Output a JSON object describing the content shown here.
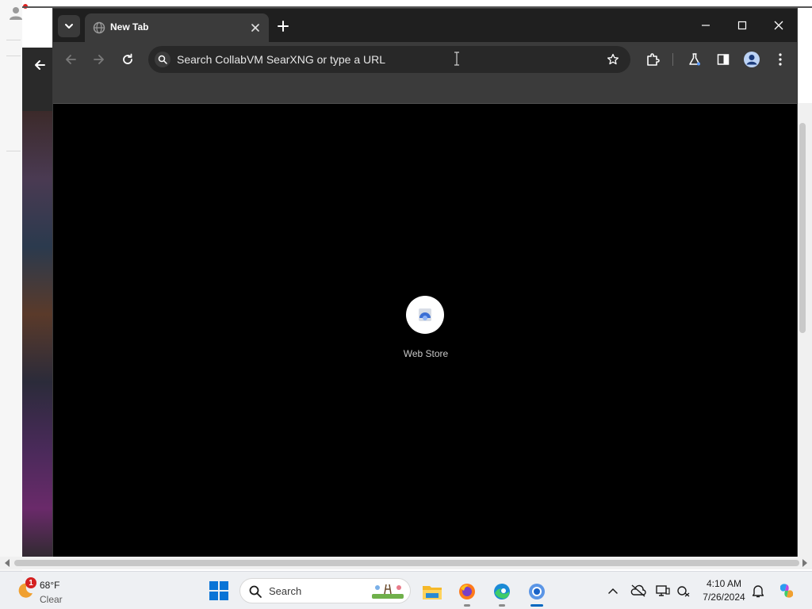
{
  "browser": {
    "tab": {
      "title": "New Tab",
      "favicon": "globe-icon"
    },
    "omnibox": {
      "placeholder": "Search CollabVM SearXNG or type a URL"
    },
    "shortcuts": [
      {
        "label": "Web Store",
        "icon": "web-store-icon"
      }
    ],
    "colors": {
      "titlebar": "#1f1f1f",
      "toolbar": "#3b3b3b",
      "content": "#000000"
    }
  },
  "taskbar": {
    "weather": {
      "badge": "1",
      "temperature": "68°F",
      "condition": "Clear"
    },
    "search": {
      "placeholder": "Search"
    },
    "apps": [
      "start-icon",
      "file-explorer-icon",
      "firefox-icon",
      "edge-icon",
      "chrome-icon"
    ],
    "tray": [
      "chevron-up-icon",
      "onedrive-offline-icon",
      "display-icon",
      "network-icon",
      "notification-bell-icon",
      "copilot-icon"
    ],
    "clock": {
      "time": "4:10 AM",
      "date": "7/26/2024"
    }
  }
}
